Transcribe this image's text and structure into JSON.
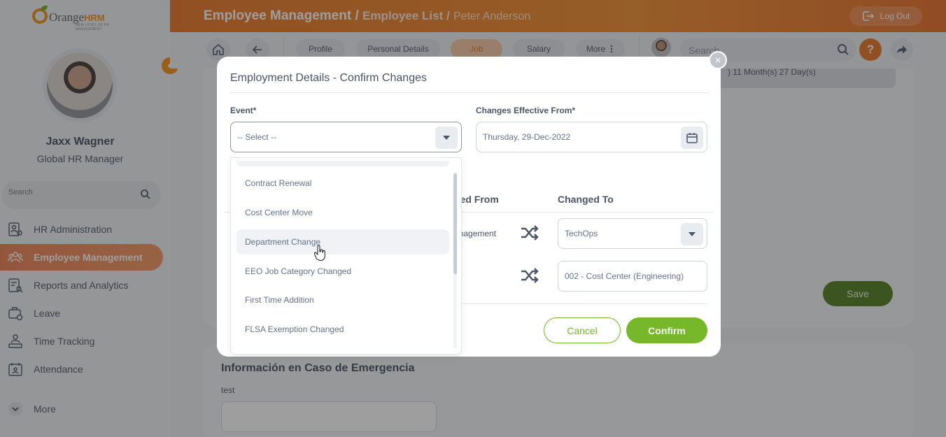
{
  "app": {
    "logo_text": "Orange",
    "logo_hrm": "HRM",
    "logo_tagline": "NEW LEVEL OF HR MANAGEMENT"
  },
  "header": {
    "title_main": "Employee Management /",
    "title_sub": "Employee List /",
    "title_last": "Peter Anderson",
    "logout_label": "Log Out"
  },
  "sidebar": {
    "user_name": "Jaxx Wagner",
    "user_role": "Global HR Manager",
    "search_placeholder": "Search",
    "items": [
      {
        "label": "HR Administration",
        "icon": "hr-admin-icon"
      },
      {
        "label": "Employee Management",
        "icon": "employee-mgmt-icon",
        "active": true
      },
      {
        "label": "Reports and Analytics",
        "icon": "reports-icon"
      },
      {
        "label": "Leave",
        "icon": "leave-icon"
      },
      {
        "label": "Time Tracking",
        "icon": "time-tracking-icon"
      },
      {
        "label": "Attendance",
        "icon": "attendance-icon"
      },
      {
        "label": "More",
        "icon": "chevron-down-icon"
      }
    ]
  },
  "tabs": [
    {
      "label": "Profile"
    },
    {
      "label": "Personal Details"
    },
    {
      "label": "Job",
      "active": true
    },
    {
      "label": "Salary"
    },
    {
      "label": "More"
    }
  ],
  "top_search": {
    "placeholder": "Search"
  },
  "help_label": "?",
  "background": {
    "duration_text": ") 11 Month(s) 27 Day(s)",
    "save_label": "Save",
    "emergency_title": "Información en Caso de Emergencia",
    "emergency_field_label": "test"
  },
  "modal": {
    "title": "Employment Details - Confirm Changes",
    "event_label": "Event*",
    "event_value": "-- Select --",
    "effective_label": "Changes Effective From*",
    "effective_value": "Thursday, 29-Dec-2022",
    "col_changed_from": "ged From",
    "col_changed_to": "Changed To",
    "rows": [
      {
        "from": "anagement",
        "to": "TechOps"
      },
      {
        "from": "",
        "to": "002 - Cost Center (Engineering)"
      }
    ],
    "cancel_label": "Cancel",
    "confirm_label": "Confirm",
    "close_label": "×"
  },
  "dropdown": {
    "options": [
      "Contract Renewal",
      "Cost Center Move",
      "Department Change",
      "EEO Job Category Changed",
      "First Time Addition",
      "FLSA Exemption Changed"
    ],
    "hovered": "Department Change"
  },
  "colors": {
    "brand_orange": "#e8721f",
    "brand_green": "#76b82a",
    "active_nav": "#ec7d4f"
  }
}
